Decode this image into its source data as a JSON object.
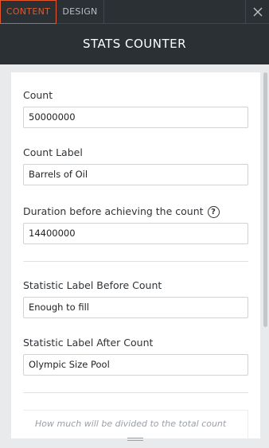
{
  "tabs": [
    {
      "label": "CONTENT",
      "active": true
    },
    {
      "label": "DESIGN",
      "active": false
    }
  ],
  "close_icon": "close-icon",
  "header": {
    "title": "STATS COUNTER"
  },
  "fields": {
    "count": {
      "label": "Count",
      "value": "50000000"
    },
    "count_label": {
      "label": "Count Label",
      "value": "Barrels of Oil"
    },
    "duration": {
      "label": "Duration before achieving the count",
      "value": "14400000",
      "help_icon": "?"
    },
    "label_before": {
      "label": "Statistic Label Before Count",
      "value": "Enough to fill"
    },
    "label_after": {
      "label": "Statistic Label After Count",
      "value": "Olympic Size Pool"
    }
  },
  "hint": {
    "text": "How much will be divided to the total count"
  },
  "colors": {
    "accent": "#e2572c",
    "dark": "#2b3035",
    "panel_bg": "#e8eaec"
  }
}
